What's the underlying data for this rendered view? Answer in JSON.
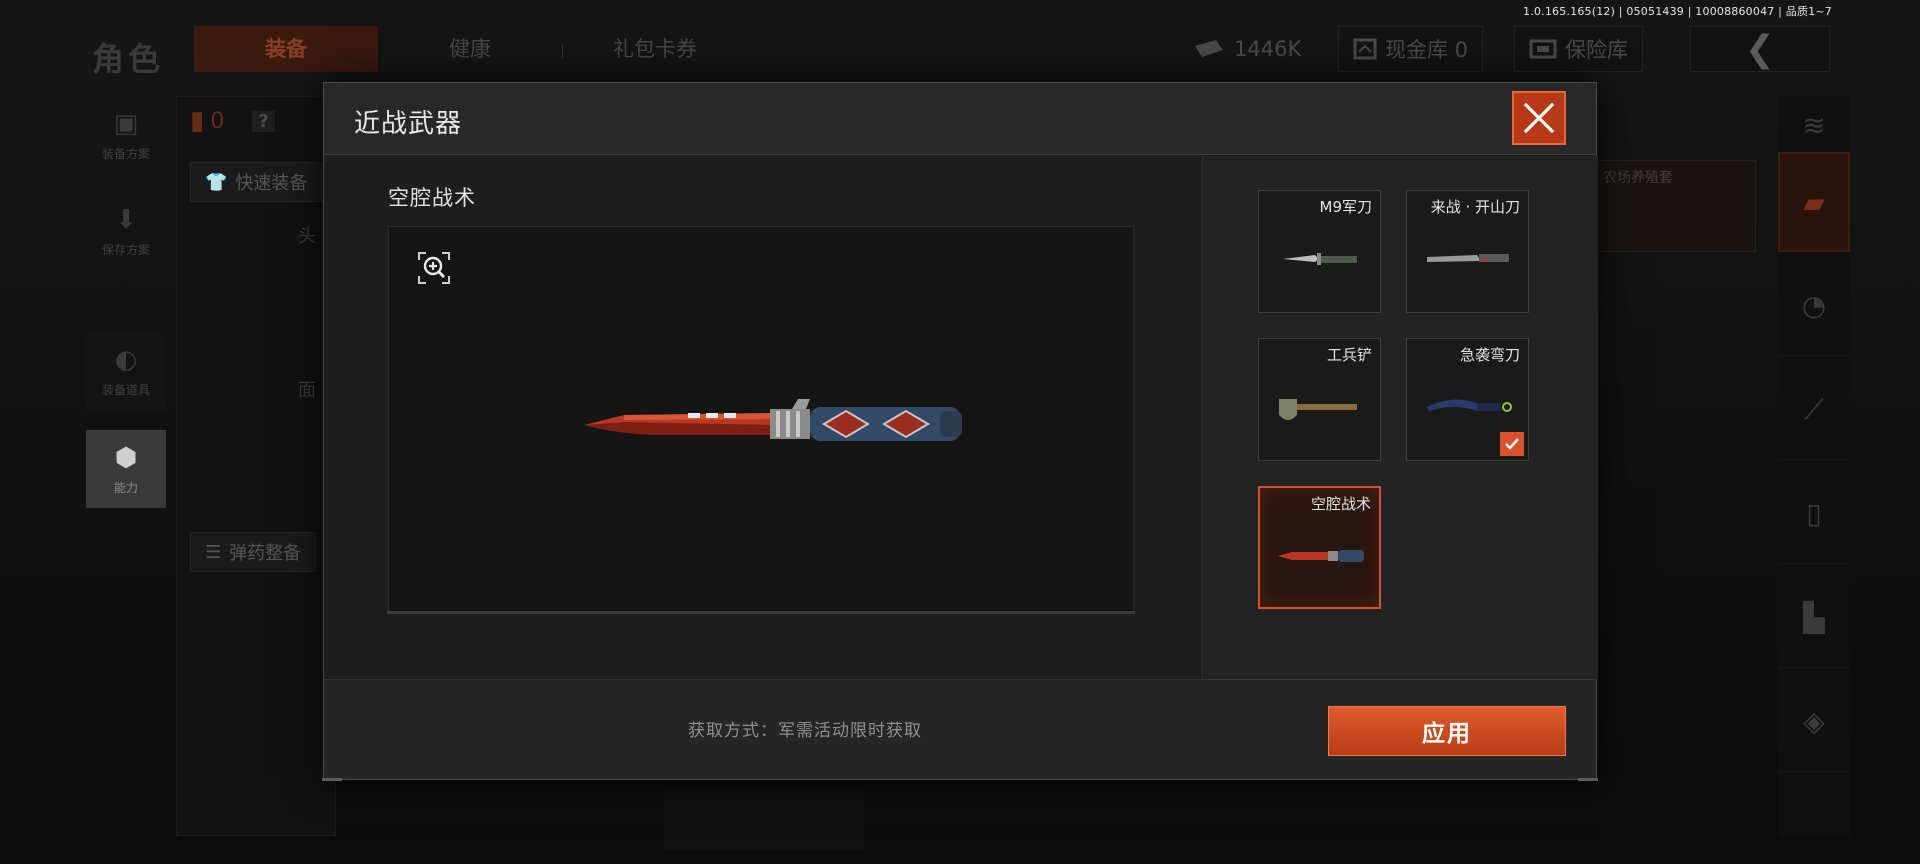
{
  "version_info": "1.0.165.165(12) | 05051439 | 10008860047 | 品质1~7",
  "background": {
    "page_title": "角色",
    "tabs": [
      {
        "label": "装备",
        "active": true
      },
      {
        "label": "健康",
        "active": false
      },
      {
        "label": "礼包卡券",
        "active": false
      }
    ],
    "currency": {
      "icon": "banknote-icon",
      "value": "1446K"
    },
    "cash_vault": {
      "icon": "cash-vault-icon",
      "label": "现金库 0"
    },
    "safe_box": {
      "icon": "safe-box-icon",
      "label": "保险库"
    },
    "back_icon": "chevron-left-icon",
    "left_nav": [
      {
        "label": "装备方案",
        "icon": "vest-icon",
        "active": false
      },
      {
        "label": "保存方案",
        "icon": "download-icon",
        "active": false
      },
      {
        "label": "装备道具",
        "icon": "helmet-icon",
        "active": false
      },
      {
        "label": "能力",
        "icon": "lightning-icon",
        "active": true
      }
    ],
    "armor_count": "0",
    "help_label": "?",
    "quick_equip": "快速装备",
    "slot_head": "头",
    "slot_face": "面",
    "ammo_equip": "弹药整备",
    "side_cards": "农场养殖套",
    "accent_color": "#d9512a"
  },
  "modal": {
    "title": "近战武器",
    "close_icon": "close-icon",
    "zoom_icon": "zoom-in-icon",
    "selected_weapon_name": "空腔战术",
    "items": [
      {
        "label": "M9军刀",
        "icon": "bayonet-knife-icon",
        "selected": false,
        "equipped": false
      },
      {
        "label": "来战 · 开山刀",
        "icon": "machete-icon",
        "selected": false,
        "equipped": false
      },
      {
        "label": "工兵铲",
        "icon": "shovel-icon",
        "selected": false,
        "equipped": false
      },
      {
        "label": "急袭弯刀",
        "icon": "karambit-icon",
        "selected": false,
        "equipped": true
      },
      {
        "label": "空腔战术",
        "icon": "tactical-knife-icon",
        "selected": true,
        "equipped": false
      }
    ],
    "acquire_text": "获取方式：军需活动限时获取",
    "apply_label": "应用"
  }
}
